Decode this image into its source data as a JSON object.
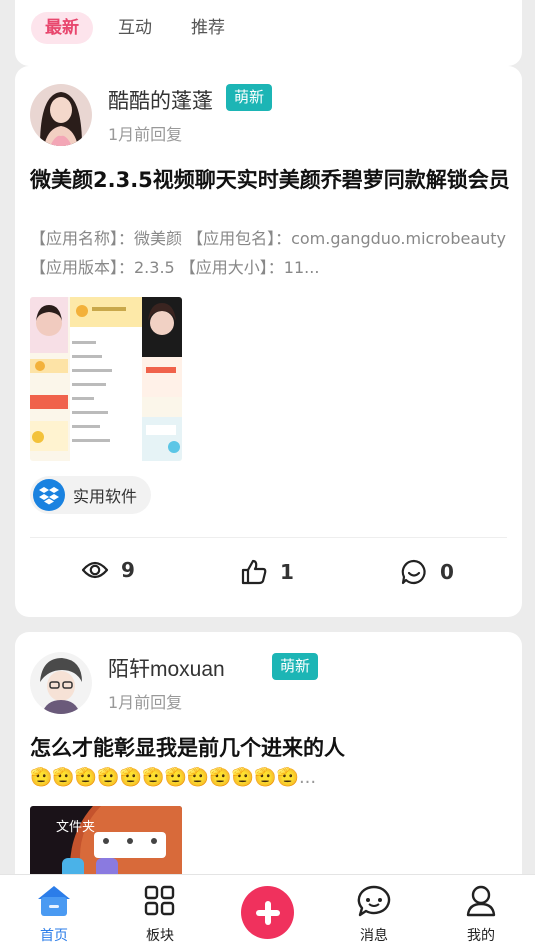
{
  "tabs": [
    {
      "label": "最新",
      "active": true
    },
    {
      "label": "互动",
      "active": false
    },
    {
      "label": "推荐",
      "active": false
    }
  ],
  "posts": [
    {
      "username": "酷酷的蓬蓬",
      "badge": "萌新",
      "time": "1月前回复",
      "title": "微美颜2.3.5视频聊天实时美颜乔碧萝同款解锁会员",
      "description": "【应用名称】：微美颜 【应用包名】：com.gangduo.microbeauty 【应用版本】：2.3.5 【应用大小】：11...",
      "tag": {
        "label": "实用软件",
        "icon": "dropbox-icon"
      },
      "stats": {
        "views": "9",
        "likes": "1",
        "comments": "0"
      }
    },
    {
      "username": "陌轩moxuan",
      "badge": "萌新",
      "time": "1月前回复",
      "title": "怎么才能彰显我是前几个进来的人",
      "emoji_text": "🫡🫡🫡🫡🫡🫡🫡🫡🫡🫡🫡🫡...",
      "thumb_text": "文件夹"
    }
  ],
  "nav": {
    "home": "首页",
    "board": "板块",
    "messages": "消息",
    "me": "我的"
  },
  "colors": {
    "accent_pink": "#e8476e",
    "badge_teal": "#1cb5b5",
    "fab_red": "#f0315d",
    "nav_active_blue": "#2b7de9"
  }
}
